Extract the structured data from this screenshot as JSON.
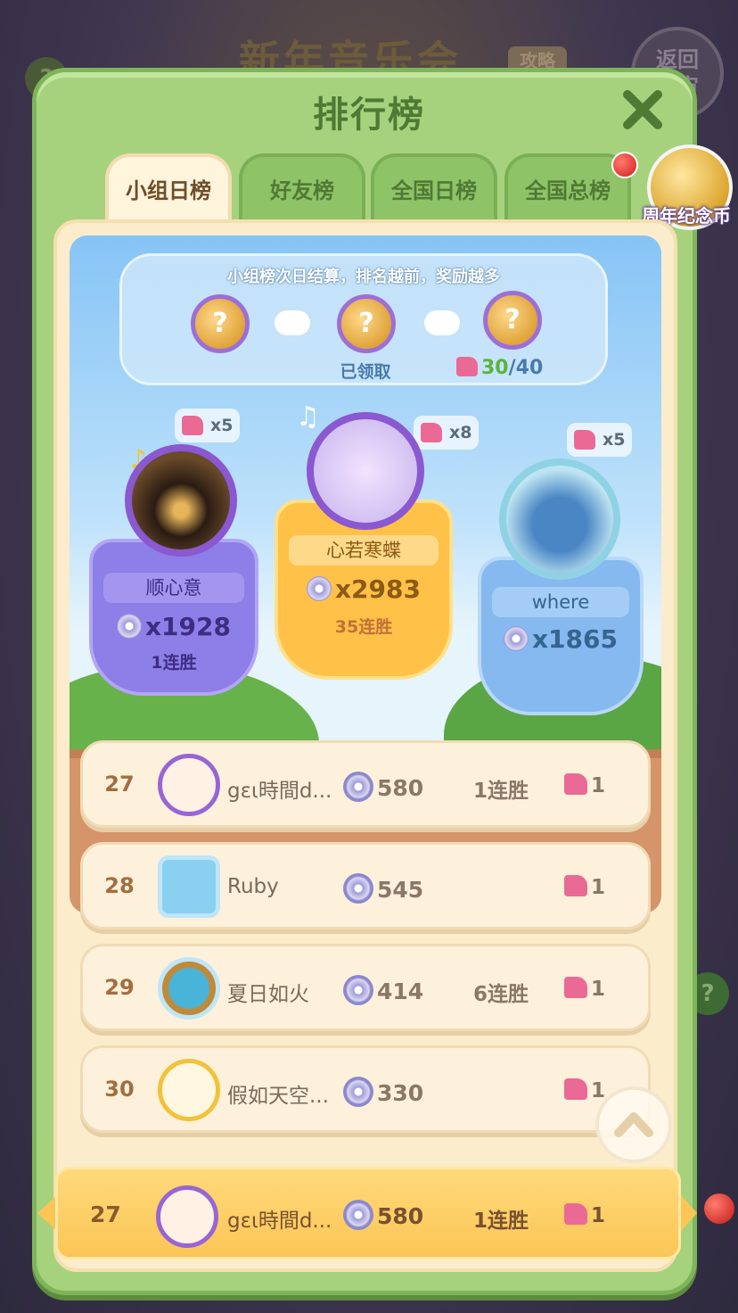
{
  "background": {
    "event_title": "新年音乐会",
    "guide_label": "攻略",
    "back_label_line1": "返回",
    "back_label_line2": "宇宙",
    "help_label": "?"
  },
  "panel": {
    "title": "排行榜",
    "close_icon": "close-icon"
  },
  "tabs": [
    {
      "label": "小组日榜",
      "active": true
    },
    {
      "label": "好友榜",
      "active": false
    },
    {
      "label": "全国日榜",
      "active": false
    },
    {
      "label": "全国总榜",
      "active": false
    }
  ],
  "anniversary": {
    "label": "周年纪念币"
  },
  "rewards": {
    "title": "小组榜次日结算，排名越前，奖励越多",
    "chest_symbol": "?",
    "claimed_label": "已领取",
    "progress_current": "30",
    "progress_total": "/40"
  },
  "podium": {
    "first": {
      "name": "心若寒蝶",
      "score": "x2983",
      "streak": "35连胜",
      "gift": "x8"
    },
    "second": {
      "name": "顺心意",
      "score": "x1928",
      "streak": "1连胜",
      "gift": "x5"
    },
    "third": {
      "name": "where",
      "score": "x1865",
      "streak": "",
      "gift": "x5"
    }
  },
  "rows": [
    {
      "rank": "27",
      "name": "gɛι時間d...",
      "score": "580",
      "streak": "1连胜",
      "gift": "1"
    },
    {
      "rank": "28",
      "name": "Ruby",
      "score": "545",
      "streak": "",
      "gift": "1"
    },
    {
      "rank": "29",
      "name": "夏日如火",
      "score": "414",
      "streak": "6连胜",
      "gift": "1"
    },
    {
      "rank": "30",
      "name": "假如天空...",
      "score": "330",
      "streak": "",
      "gift": "1"
    }
  ],
  "me": {
    "rank": "27",
    "name": "gɛι時間d...",
    "score": "580",
    "streak": "1连胜",
    "gift": "1"
  },
  "colors": {
    "panel_green": "#a6d27d",
    "cream": "#fbeccb",
    "first_gold": "#ffc147",
    "second_purple": "#8e7ee8",
    "third_blue": "#85b9f0"
  }
}
